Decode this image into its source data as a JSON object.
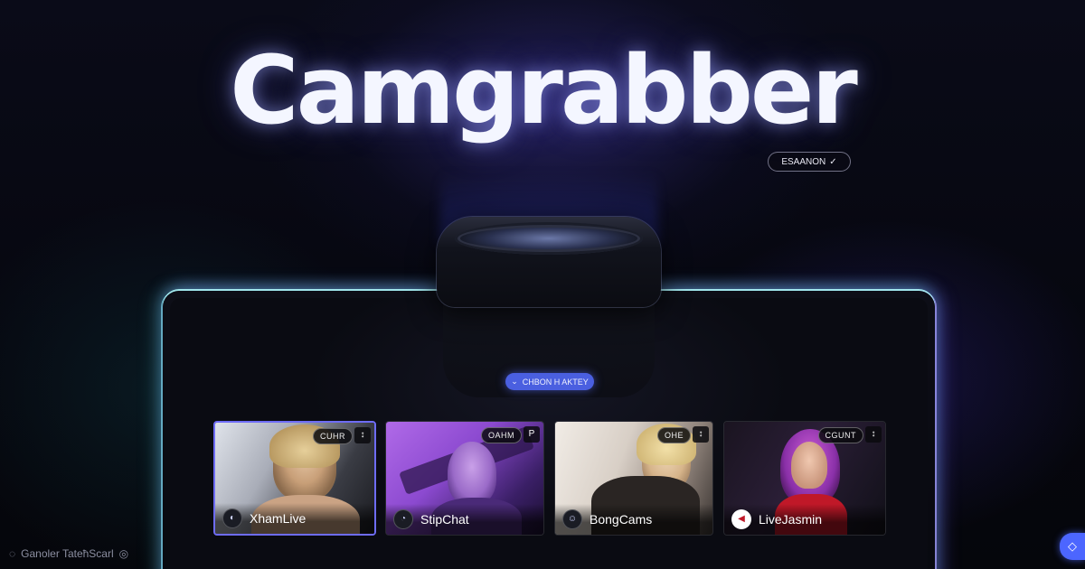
{
  "hero": {
    "title": "Camgrabber",
    "top_pill_label": "ESAANON",
    "top_pill_check": "✓",
    "status_pill_label": "CHBON H AKTEY",
    "status_pill_chevron": "⌄"
  },
  "cards": [
    {
      "site": "XhamLive",
      "badge": "CUHR",
      "corner": "↕",
      "active": true
    },
    {
      "site": "StipChat",
      "badge": "OAHM",
      "corner": "P",
      "active": false
    },
    {
      "site": "BongCams",
      "badge": "OHE",
      "corner": "↕",
      "active": false
    },
    {
      "site": "LiveJasmin",
      "badge": "CGUNT",
      "corner": "↕",
      "active": false
    }
  ],
  "footer": {
    "text": "Ganoler TateħScarl",
    "icons": [
      "circle-icon",
      "help-icon"
    ]
  },
  "colors": {
    "accent": "#4c66ff",
    "active_border": "#6e6cf6",
    "glow_cyan": "#a8f0ff"
  }
}
